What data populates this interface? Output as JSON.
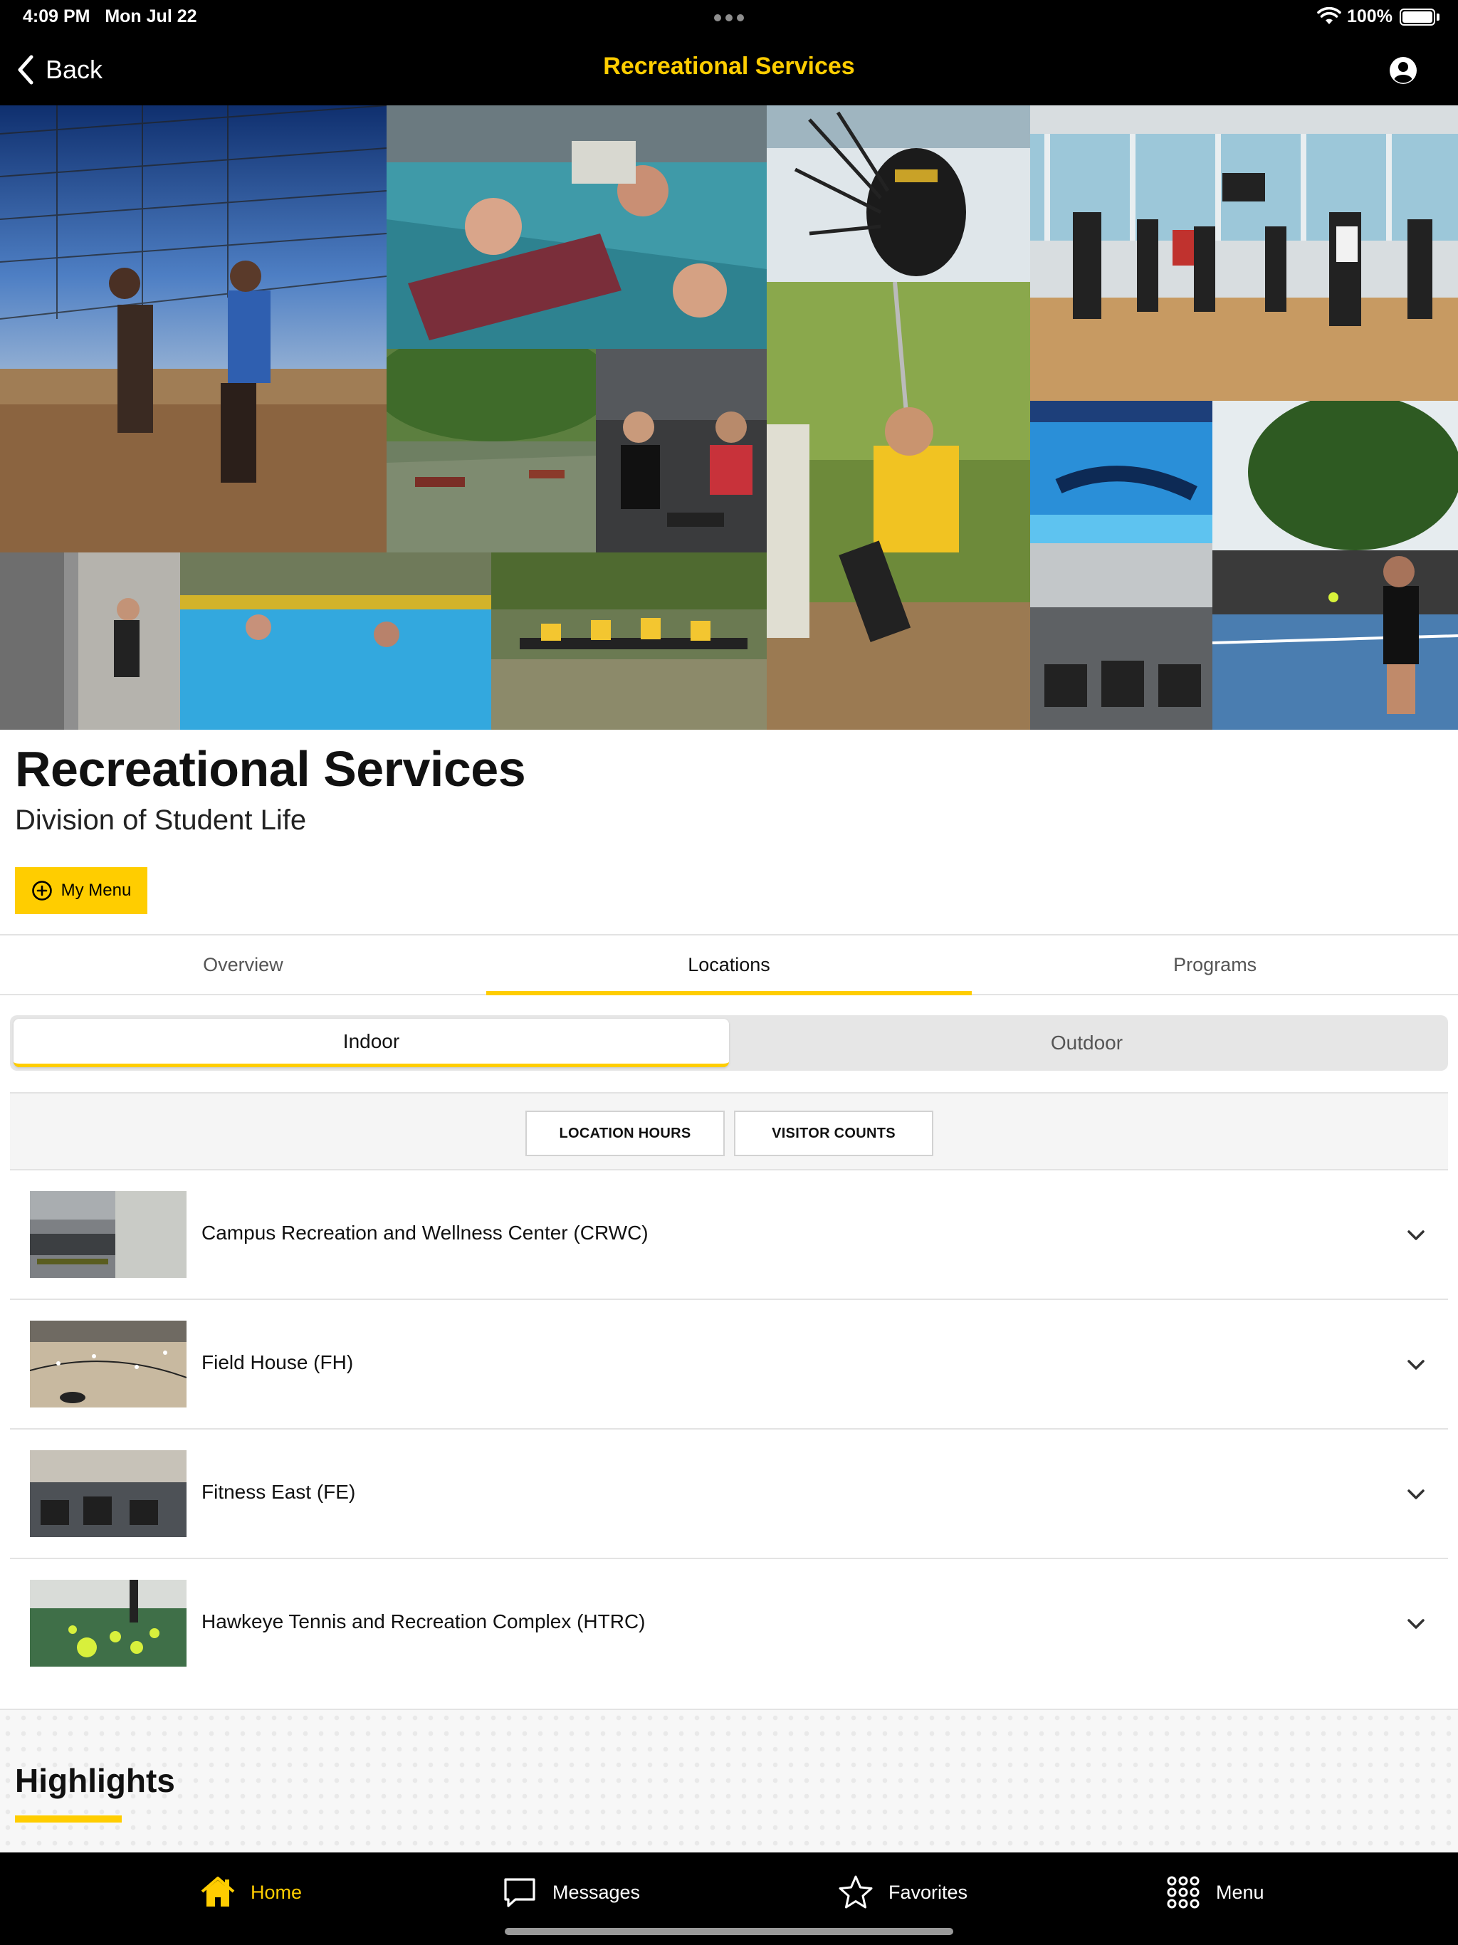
{
  "status_bar": {
    "time": "4:09 PM",
    "date": "Mon Jul 22",
    "battery": "100%",
    "battery_level": 1.0,
    "icons": [
      "wifi-icon",
      "battery-icon"
    ]
  },
  "nav": {
    "back_label": "Back",
    "title": "Recreational Services",
    "icons": [
      "chevron-left-icon",
      "user-profile-icon"
    ]
  },
  "header": {
    "title": "Recreational Services",
    "subtitle": "Division of Student Life",
    "my_menu_label": "My Menu",
    "my_menu_icon": "plus-circle-icon"
  },
  "tabs": [
    {
      "label": "Overview",
      "active": false
    },
    {
      "label": "Locations",
      "active": true
    },
    {
      "label": "Programs",
      "active": false
    }
  ],
  "segment": [
    {
      "label": "Indoor",
      "active": true
    },
    {
      "label": "Outdoor",
      "active": false
    }
  ],
  "actions": {
    "location_hours": "LOCATION HOURS",
    "visitor_counts": "VISITOR COUNTS"
  },
  "locations": [
    {
      "name": "Campus Recreation and Wellness Center (CRWC)",
      "icon": "chevron-down-icon"
    },
    {
      "name": "Field House (FH)",
      "icon": "chevron-down-icon"
    },
    {
      "name": "Fitness East (FE)",
      "icon": "chevron-down-icon"
    },
    {
      "name": "Hawkeye Tennis and Recreation Complex (HTRC)",
      "icon": "chevron-down-icon"
    }
  ],
  "highlights": {
    "title": "Highlights"
  },
  "tab_bar": [
    {
      "label": "Home",
      "icon": "home-icon",
      "active": true
    },
    {
      "label": "Messages",
      "icon": "chat-bubble-icon",
      "active": false
    },
    {
      "label": "Favorites",
      "icon": "star-icon",
      "active": false
    },
    {
      "label": "Menu",
      "icon": "grid-icon",
      "active": false
    }
  ],
  "colors": {
    "accent": "#FFCD00",
    "bar_background": "#000000",
    "divider": "#E3E3E3"
  }
}
